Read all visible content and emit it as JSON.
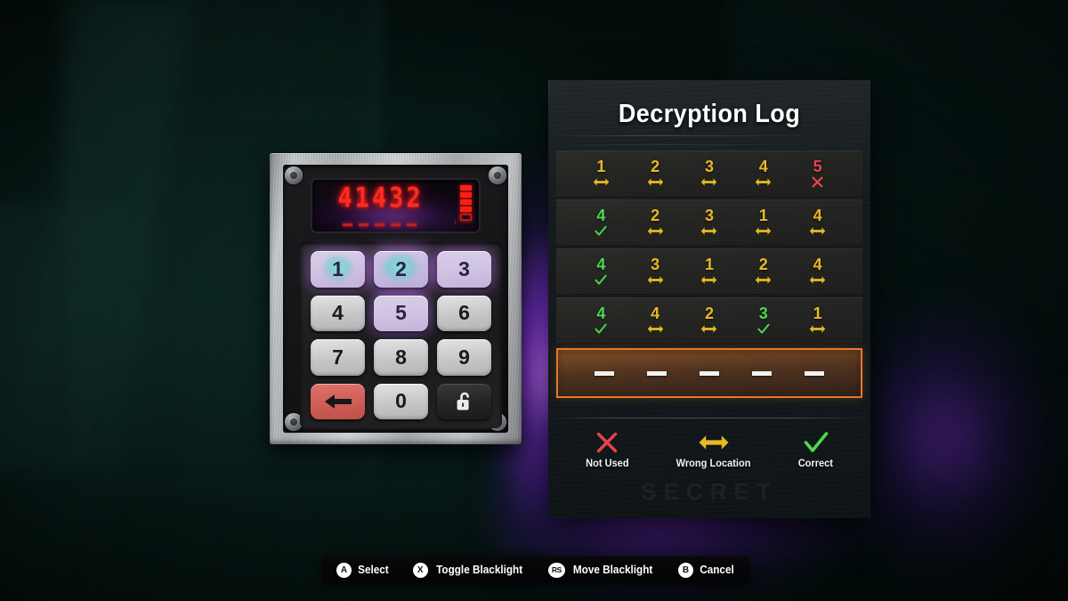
{
  "background": {
    "scene_tint": "#0a201d",
    "uv_glow_color": "#9b3cf5"
  },
  "keypad": {
    "display": {
      "value": "41432",
      "slot_count": 5,
      "bar_indicator_segments": 5,
      "cursor_glyph": "›",
      "led_color": "#ff2a20"
    },
    "keys": [
      {
        "name": "key-1",
        "label": "1",
        "uv_lit": true,
        "smudge": "partial"
      },
      {
        "name": "key-2",
        "label": "2",
        "uv_lit": true,
        "smudge": "full"
      },
      {
        "name": "key-3",
        "label": "3",
        "uv_lit": true,
        "smudge": "none"
      },
      {
        "name": "key-4",
        "label": "4",
        "uv_lit": false,
        "smudge": "none"
      },
      {
        "name": "key-5",
        "label": "5",
        "uv_lit": true,
        "smudge": "none"
      },
      {
        "name": "key-6",
        "label": "6",
        "uv_lit": false,
        "smudge": "none"
      },
      {
        "name": "key-7",
        "label": "7",
        "uv_lit": false,
        "smudge": "none"
      },
      {
        "name": "key-8",
        "label": "8",
        "uv_lit": false,
        "smudge": "none"
      },
      {
        "name": "key-9",
        "label": "9",
        "uv_lit": false,
        "smudge": "none"
      },
      {
        "name": "key-backspace",
        "label": "",
        "icon": "back-arrow-icon",
        "uv_lit": false,
        "smudge": "none"
      },
      {
        "name": "key-0",
        "label": "0",
        "uv_lit": false,
        "smudge": "none"
      },
      {
        "name": "key-unlock",
        "label": "",
        "icon": "unlock-padlock-icon",
        "uv_lit": false,
        "smudge": "none"
      }
    ]
  },
  "log_panel": {
    "title": "Decryption Log",
    "stencil_text": "SECRET",
    "rows": [
      {
        "cells": [
          {
            "digit": "1",
            "status": "wrong-location"
          },
          {
            "digit": "2",
            "status": "wrong-location"
          },
          {
            "digit": "3",
            "status": "wrong-location"
          },
          {
            "digit": "4",
            "status": "wrong-location"
          },
          {
            "digit": "5",
            "status": "not-used"
          }
        ]
      },
      {
        "cells": [
          {
            "digit": "4",
            "status": "correct"
          },
          {
            "digit": "2",
            "status": "wrong-location"
          },
          {
            "digit": "3",
            "status": "wrong-location"
          },
          {
            "digit": "1",
            "status": "wrong-location"
          },
          {
            "digit": "4",
            "status": "wrong-location"
          }
        ]
      },
      {
        "cells": [
          {
            "digit": "4",
            "status": "correct"
          },
          {
            "digit": "3",
            "status": "wrong-location"
          },
          {
            "digit": "1",
            "status": "wrong-location"
          },
          {
            "digit": "2",
            "status": "wrong-location"
          },
          {
            "digit": "4",
            "status": "wrong-location"
          }
        ]
      },
      {
        "cells": [
          {
            "digit": "4",
            "status": "correct"
          },
          {
            "digit": "4",
            "status": "wrong-location"
          },
          {
            "digit": "2",
            "status": "wrong-location"
          },
          {
            "digit": "3",
            "status": "correct"
          },
          {
            "digit": "1",
            "status": "wrong-location"
          }
        ]
      }
    ],
    "active_row": {
      "slots": [
        "—",
        "—",
        "—",
        "—",
        "—"
      ],
      "border_color": "#e8772a"
    },
    "legend": [
      {
        "icon": "x-mark-icon",
        "label": "Not Used",
        "color": "#e8434b"
      },
      {
        "icon": "double-arrow-icon",
        "label": "Wrong Location",
        "color": "#e8b923"
      },
      {
        "icon": "check-mark-icon",
        "label": "Correct",
        "color": "#4ed94e"
      }
    ],
    "status_colors": {
      "correct": "#4ed94e",
      "wrong-location": "#e8b923",
      "not-used": "#e8434b"
    }
  },
  "controls": [
    {
      "button": "A",
      "label": "Select"
    },
    {
      "button": "X",
      "label": "Toggle Blacklight"
    },
    {
      "button": "RS",
      "label": "Move Blacklight"
    },
    {
      "button": "B",
      "label": "Cancel"
    }
  ]
}
